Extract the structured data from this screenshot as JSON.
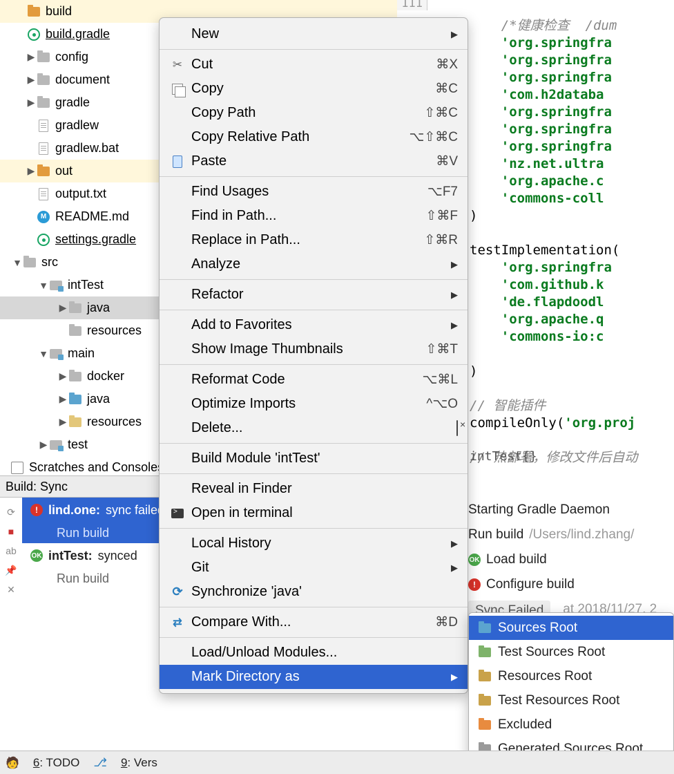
{
  "tree": {
    "build": "build",
    "build_gradle": "build.gradle",
    "config": "config",
    "document": "document",
    "gradle": "gradle",
    "gradlew": "gradlew",
    "gradlew_bat": "gradlew.bat",
    "out": "out",
    "output_txt": "output.txt",
    "readme": "README.md",
    "settings_gradle": "settings.gradle",
    "src": "src",
    "intTest": "intTest",
    "java": "java",
    "resources_intTest": "resources",
    "main": "main",
    "docker": "docker",
    "main_java": "java",
    "main_resources": "resources",
    "test": "test",
    "scratches": "Scratches and Consoles"
  },
  "gutter": {
    "line": "111"
  },
  "editor_lines": [
    "    /*健康检查  /dum",
    "    'org.springfra",
    "    'org.springfra",
    "    'org.springfra",
    "    'com.h2databa",
    "    'org.springfra",
    "    'org.springfra",
    "    'org.springfra",
    "    'nz.net.ultra",
    "    'org.apache.c",
    "    'commons-coll",
    ")",
    "",
    "testImplementation(",
    "    'org.springfra",
    "    'com.github.k",
    "    'de.flapdoodl",
    "    'org.apache.q",
    "    'commons-io:c",
    "",
    ")",
    "",
    "// 智能插件",
    "compileOnly('org.proj",
    "",
    "// 热部署，修改文件后自动"
  ],
  "editor_tab": "intTest{}",
  "build": {
    "header": "Build: Sync",
    "entries": [
      {
        "name": "lind.one:",
        "status": "sync failed",
        "sub": "Run build"
      },
      {
        "name": "intTest:",
        "status": "synced",
        "sub": "Run build"
      }
    ]
  },
  "sync_panel": {
    "r1": "Starting Gradle Daemon",
    "r2a": "Run build",
    "r2b": "/Users/lind.zhang/",
    "r3": "Load build",
    "r4": "Configure build",
    "r5": "Sync Failed",
    "r5b": "at 2018/11/27, 2"
  },
  "ctx": {
    "new": "New",
    "cut": "Cut",
    "cut_sc": "⌘X",
    "copy": "Copy",
    "copy_sc": "⌘C",
    "copy_path": "Copy Path",
    "copy_path_sc": "⇧⌘C",
    "copy_rel": "Copy Relative Path",
    "copy_rel_sc": "⌥⇧⌘C",
    "paste": "Paste",
    "paste_sc": "⌘V",
    "find_usages": "Find Usages",
    "find_usages_sc": "⌥F7",
    "find_path": "Find in Path...",
    "find_path_sc": "⇧⌘F",
    "replace_path": "Replace in Path...",
    "replace_path_sc": "⇧⌘R",
    "analyze": "Analyze",
    "refactor": "Refactor",
    "favorites": "Add to Favorites",
    "thumbs": "Show Image Thumbnails",
    "thumbs_sc": "⇧⌘T",
    "reformat": "Reformat Code",
    "reformat_sc": "⌥⌘L",
    "optimize": "Optimize Imports",
    "optimize_sc": "^⌥O",
    "delete": "Delete...",
    "build_mod": "Build Module 'intTest'",
    "reveal": "Reveal in Finder",
    "open_term": "Open in terminal",
    "local_hist": "Local History",
    "git": "Git",
    "sync": "Synchronize 'java'",
    "compare": "Compare With...",
    "compare_sc": "⌘D",
    "load_unload": "Load/Unload Modules...",
    "mark_dir": "Mark Directory as"
  },
  "submenu": {
    "sources": "Sources Root",
    "test_sources": "Test Sources Root",
    "resources": "Resources Root",
    "test_resources": "Test Resources Root",
    "excluded": "Excluded",
    "generated": "Generated Sources Root"
  },
  "bottom": {
    "todo": "6: TODO",
    "vcs": "9: Vers"
  }
}
